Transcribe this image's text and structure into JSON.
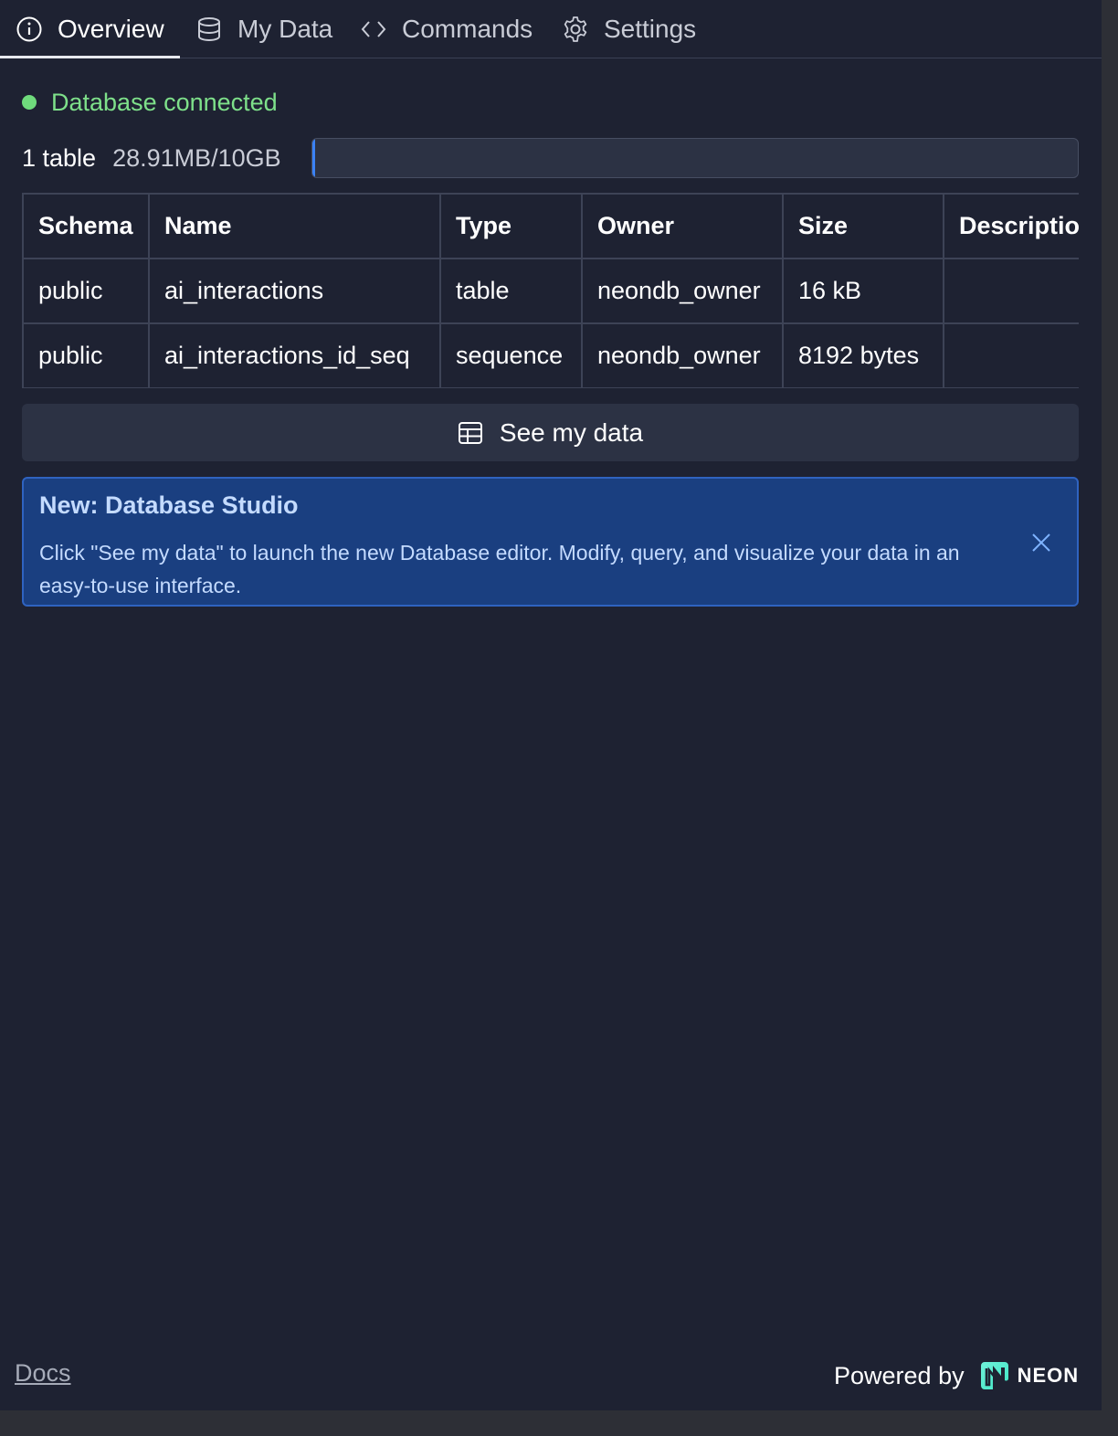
{
  "tabs": [
    {
      "label": "Overview",
      "icon": "info-icon",
      "active": true
    },
    {
      "label": "My Data",
      "icon": "database-icon",
      "active": false
    },
    {
      "label": "Commands",
      "icon": "code-icon",
      "active": false
    },
    {
      "label": "Settings",
      "icon": "gear-icon",
      "active": false
    }
  ],
  "status": {
    "text": "Database connected",
    "color": "#6fdb7c"
  },
  "summary": {
    "table_count": "1 table",
    "usage": "28.91MB/10GB",
    "usage_fraction": 0.0028
  },
  "table": {
    "headers": [
      "Schema",
      "Name",
      "Type",
      "Owner",
      "Size",
      "Descriptio"
    ],
    "rows": [
      [
        "public",
        "ai_interactions",
        "table",
        "neondb_owner",
        "16 kB",
        ""
      ],
      [
        "public",
        "ai_interactions_id_seq",
        "sequence",
        "neondb_owner",
        "8192 bytes",
        ""
      ]
    ]
  },
  "see_data_button": {
    "label": "See my data",
    "icon": "table-icon"
  },
  "notice": {
    "title": "New: Database Studio",
    "body": "Click \"See my data\" to launch the new Database editor. Modify, query, and visualize your data in an easy-to-use interface."
  },
  "footer": {
    "docs_link": "Docs",
    "powered_by": "Powered by",
    "brand": "NEON",
    "brand_color": "#3ee6c5"
  }
}
